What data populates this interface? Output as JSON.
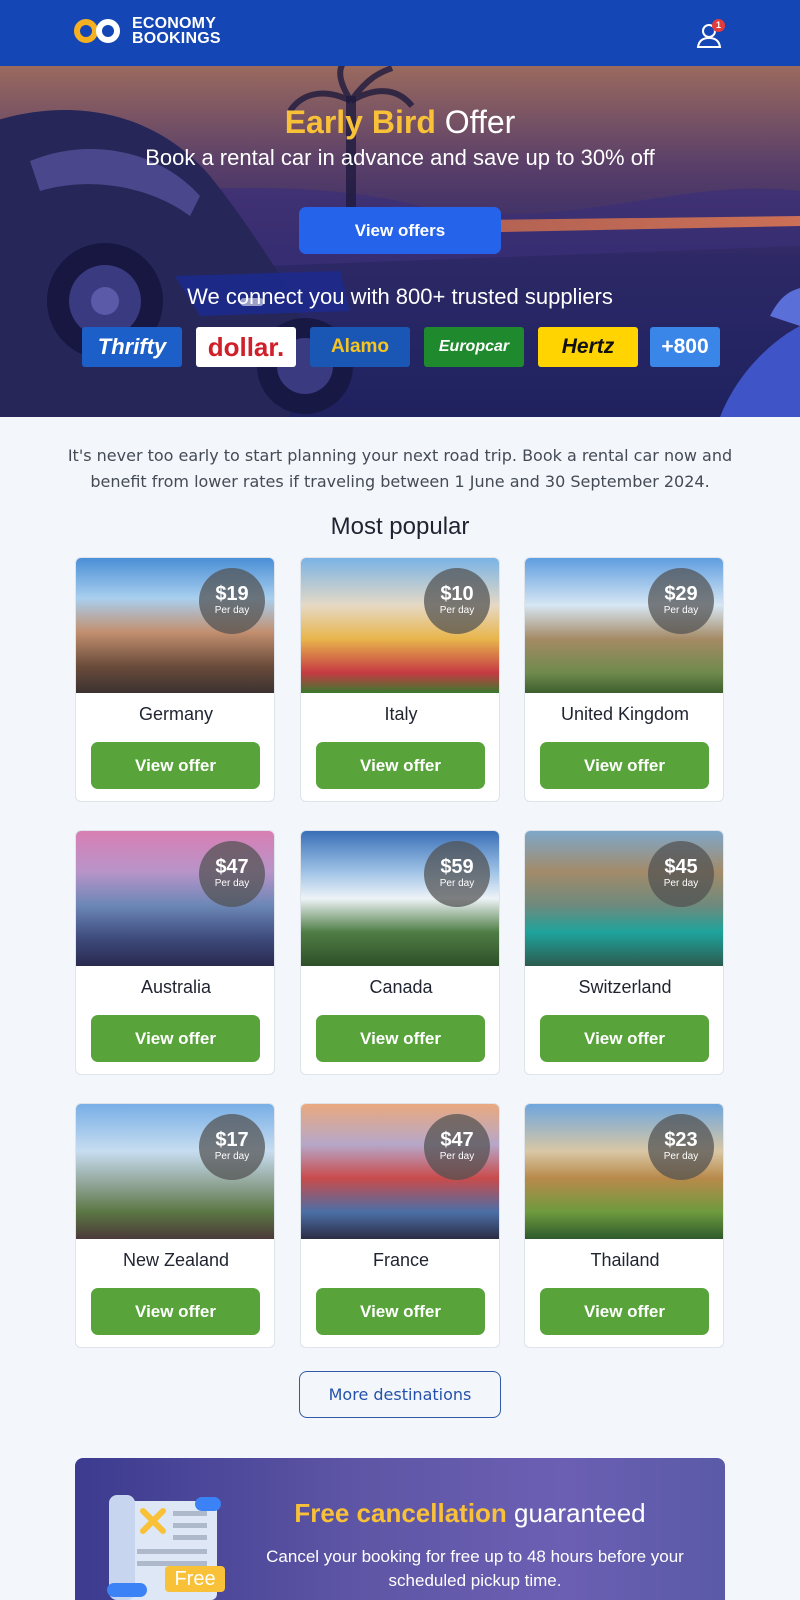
{
  "header": {
    "brand_line1": "ECONOMY",
    "brand_line2": "BOOKINGS",
    "user_badge_count": "1",
    "colors": {
      "bar": "#1446b5",
      "logo_ring": "#f5b021"
    }
  },
  "hero": {
    "title_accent": "Early Bird",
    "title_rest": "Offer",
    "subtitle": "Book a rental car in advance and save up to 30% off",
    "cta_label": "View offers",
    "suppliers_text": "We connect you with 800+ trusted suppliers",
    "brands": [
      "Thrifty",
      "dollar.",
      "Alamo",
      "Europcar",
      "Hertz",
      "+800"
    ]
  },
  "intro": {
    "text": "It's never too early to start planning your next road trip. Book a rental car now and benefit from lower rates if traveling between 1 June and 30 September 2024."
  },
  "popular": {
    "title": "Most popular",
    "cards": [
      {
        "name": "Germany",
        "price": "$19",
        "per": "Per day",
        "cta": "View offer"
      },
      {
        "name": "Italy",
        "price": "$10",
        "per": "Per day",
        "cta": "View offer"
      },
      {
        "name": "United Kingdom",
        "price": "$29",
        "per": "Per day",
        "cta": "View offer"
      },
      {
        "name": "Australia",
        "price": "$47",
        "per": "Per day",
        "cta": "View offer"
      },
      {
        "name": "Canada",
        "price": "$59",
        "per": "Per day",
        "cta": "View offer"
      },
      {
        "name": "Switzerland",
        "price": "$45",
        "per": "Per day",
        "cta": "View offer"
      },
      {
        "name": "New Zealand",
        "price": "$17",
        "per": "Per day",
        "cta": "View offer"
      },
      {
        "name": "France",
        "price": "$47",
        "per": "Per day",
        "cta": "View offer"
      },
      {
        "name": "Thailand",
        "price": "$23",
        "per": "Per day",
        "cta": "View offer"
      }
    ],
    "more_label": "More destinations"
  },
  "promo": {
    "title_accent": "Free cancellation",
    "title_rest": "guaranteed",
    "text": "Cancel your booking for free up to 48 hours before your scheduled pickup time.",
    "badge": "Free"
  }
}
